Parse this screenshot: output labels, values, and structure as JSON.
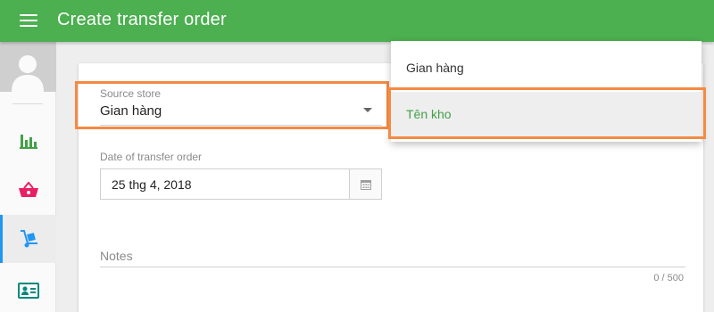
{
  "header": {
    "title": "Create transfer order"
  },
  "sidebar": {
    "items": [
      {
        "icon": "bar-chart-icon",
        "color": "#43a047"
      },
      {
        "icon": "basket-icon",
        "color": "#e91e63"
      },
      {
        "icon": "hand-truck-icon",
        "color": "#2196f3",
        "active": true
      },
      {
        "icon": "id-card-icon",
        "color": "#00897b"
      }
    ]
  },
  "form": {
    "source_store": {
      "label": "Source store",
      "value": "Gian hàng"
    },
    "transfer_date": {
      "label": "Date of transfer order",
      "value": "25 thg 4, 2018"
    },
    "notes": {
      "label": "Notes",
      "counter": "0 / 500"
    }
  },
  "dropdown": {
    "options": [
      {
        "label": "Gian hàng"
      },
      {
        "label": "Tên kho",
        "highlighted": true
      }
    ]
  },
  "colors": {
    "topbar": "#4caf50",
    "highlight_frame": "#f58a42",
    "selected_option_text": "#43a047"
  }
}
